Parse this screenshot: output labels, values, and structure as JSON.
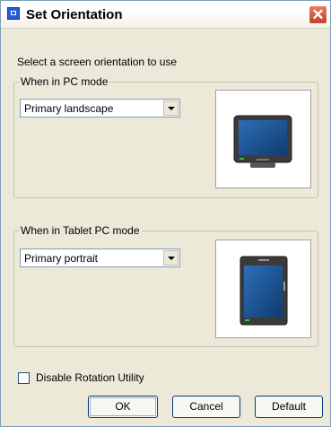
{
  "window": {
    "title": "Set Orientation",
    "close_glyph": "✕"
  },
  "instruction": "Select a screen orientation to use",
  "pc_mode": {
    "legend": "When in PC mode",
    "selected": "Primary landscape"
  },
  "tablet_mode": {
    "legend": "When in Tablet PC mode",
    "selected": "Primary portrait"
  },
  "disable_rotation": {
    "label": "Disable Rotation Utility",
    "checked": false
  },
  "buttons": {
    "ok": "OK",
    "cancel": "Cancel",
    "default": "Default"
  },
  "icons": {
    "title": "window-app-icon",
    "landscape": "tablet-landscape-icon",
    "portrait": "tablet-portrait-icon"
  }
}
